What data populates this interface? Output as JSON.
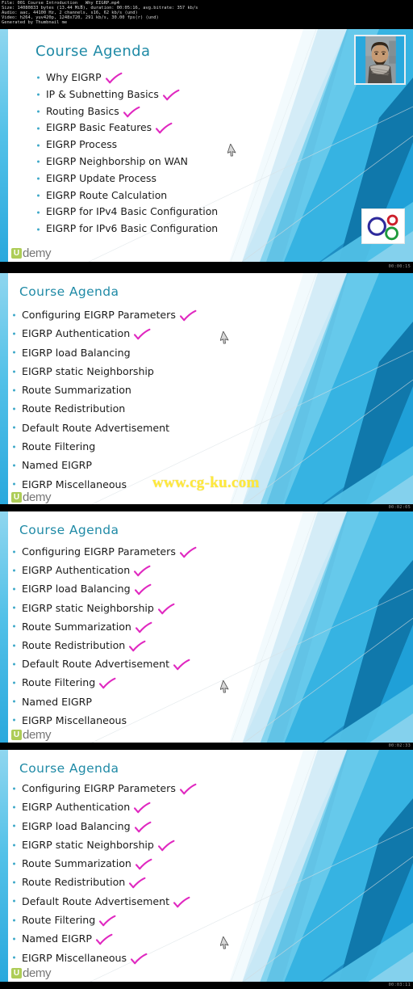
{
  "metadata": {
    "lines": [
      "File: 001 Course Introduction _ Why EIGRP.mp4",
      "Size: 14080833 bytes (13.44 MiB), duration: 00:05:16, avg.bitrate: 357 kb/s",
      "Audio: aac, 44100 Hz, 2 channels, s16, 62 kb/s (und)",
      "Video: h264, yuv420p, 1248x720, 291 kb/s, 30.00 fps(r) (und)",
      "Generated by Thumbnail me"
    ]
  },
  "watermarks": {
    "udemy_badge": "U",
    "udemy_word": "demy",
    "site": "www.cg-ku.com"
  },
  "logo": {
    "name": "tri-ring-logo",
    "ring_colors": [
      "#2e2a9c",
      "#cc1f2b",
      "#1e9a3c"
    ]
  },
  "webcam": {
    "name": "presenter-webcam",
    "alt": "presenter portrait"
  },
  "colors": {
    "title": "#1f8aa6",
    "bullet": "#3fa9c9",
    "check": "#e028c0",
    "accent_blue": "#29a8dd",
    "deep_blue": "#1a7fb5",
    "watermark_yellow": "#ffe93a"
  },
  "frames": [
    {
      "name": "thumbnail-frame-1",
      "timestamp": "00:00:15",
      "title": "Course Agenda",
      "has_webcam": true,
      "has_logo": true,
      "items": [
        {
          "label": "Why EIGRP",
          "checked": true
        },
        {
          "label": "IP & Subnetting Basics",
          "checked": true
        },
        {
          "label": "Routing Basics",
          "checked": true
        },
        {
          "label": "EIGRP Basic Features",
          "checked": true
        },
        {
          "label": "EIGRP Process",
          "checked": false
        },
        {
          "label": "EIGRP Neighborship on WAN",
          "checked": false
        },
        {
          "label": "EIGRP Update Process",
          "checked": false
        },
        {
          "label": "EIGRP Route Calculation",
          "checked": false
        },
        {
          "label": "EIGRP for IPv4 Basic Configuration",
          "checked": false
        },
        {
          "label": "EIGRP for IPv6 Basic Configuration",
          "checked": false
        }
      ],
      "cursor_after_item": 5
    },
    {
      "name": "thumbnail-frame-2",
      "timestamp": "00:02:05",
      "title": "Course Agenda",
      "has_webcam": false,
      "has_logo": false,
      "has_site_watermark": true,
      "items": [
        {
          "label": "Configuring EIGRP Parameters",
          "checked": true
        },
        {
          "label": "EIGRP  Authentication",
          "checked": true
        },
        {
          "label": "EIGRP load Balancing",
          "checked": false
        },
        {
          "label": "EIGRP static Neighborship",
          "checked": false
        },
        {
          "label": "Route Summarization",
          "checked": false
        },
        {
          "label": "Route Redistribution",
          "checked": false
        },
        {
          "label": "Default Route Advertisement",
          "checked": false
        },
        {
          "label": "Route Filtering",
          "checked": false
        },
        {
          "label": "Named EIGRP",
          "checked": false
        },
        {
          "label": "EIGRP Miscellaneous",
          "checked": false
        }
      ],
      "cursor_after_item": 2
    },
    {
      "name": "thumbnail-frame-3",
      "timestamp": "00:02:33",
      "title": "Course Agenda",
      "has_webcam": false,
      "has_logo": false,
      "items": [
        {
          "label": "Configuring EIGRP Parameters",
          "checked": true
        },
        {
          "label": "EIGRP  Authentication",
          "checked": true
        },
        {
          "label": "EIGRP load Balancing",
          "checked": true
        },
        {
          "label": "EIGRP static Neighborship",
          "checked": true
        },
        {
          "label": "Route Summarization",
          "checked": true
        },
        {
          "label": "Route Redistribution",
          "checked": true
        },
        {
          "label": "Default Route Advertisement",
          "checked": true
        },
        {
          "label": "Route Filtering",
          "checked": true
        },
        {
          "label": "Named EIGRP",
          "checked": false
        },
        {
          "label": "EIGRP Miscellaneous",
          "checked": false
        }
      ],
      "cursor_after_item": 8
    },
    {
      "name": "thumbnail-frame-4",
      "timestamp": "00:03:11",
      "title": "Course Agenda",
      "has_webcam": false,
      "has_logo": false,
      "items": [
        {
          "label": "Configuring EIGRP Parameters",
          "checked": true
        },
        {
          "label": "EIGRP  Authentication",
          "checked": true
        },
        {
          "label": "EIGRP load Balancing",
          "checked": true
        },
        {
          "label": "EIGRP static Neighborship",
          "checked": true
        },
        {
          "label": "Route Summarization",
          "checked": true
        },
        {
          "label": "Route Redistribution",
          "checked": true
        },
        {
          "label": "Default Route Advertisement",
          "checked": true
        },
        {
          "label": "Route Filtering",
          "checked": true
        },
        {
          "label": "Named EIGRP",
          "checked": true
        },
        {
          "label": "EIGRP Miscellaneous",
          "checked": true
        }
      ],
      "cursor_after_item": 9
    }
  ]
}
